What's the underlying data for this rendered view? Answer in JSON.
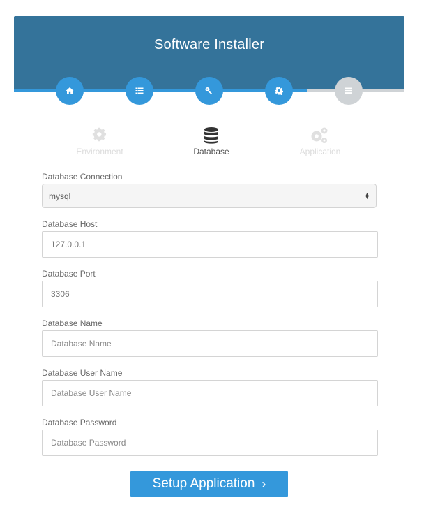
{
  "header": {
    "title": "Software Installer"
  },
  "steps": [
    {
      "icon": "home-icon",
      "state": "complete"
    },
    {
      "icon": "list-icon",
      "state": "complete"
    },
    {
      "icon": "key-icon",
      "state": "complete"
    },
    {
      "icon": "gear-icon",
      "state": "complete"
    },
    {
      "icon": "server-icon",
      "state": "inactive"
    }
  ],
  "tabs": [
    {
      "label": "Environment",
      "icon": "gear-icon",
      "state": "faded"
    },
    {
      "label": "Database",
      "icon": "database-icon",
      "state": "active"
    },
    {
      "label": "Application",
      "icon": "gears-icon",
      "state": "faded"
    }
  ],
  "form": {
    "connection": {
      "label": "Database Connection",
      "value": "mysql"
    },
    "host": {
      "label": "Database Host",
      "value": "127.0.0.1"
    },
    "port": {
      "label": "Database Port",
      "value": "3306"
    },
    "name": {
      "label": "Database Name",
      "placeholder": "Database Name"
    },
    "username": {
      "label": "Database User Name",
      "placeholder": "Database User Name"
    },
    "password": {
      "label": "Database Password",
      "placeholder": "Database Password"
    }
  },
  "submit": {
    "label": "Setup Application",
    "chevron": "›"
  },
  "colors": {
    "header": "#34739a",
    "accent": "#3498db",
    "inactive": "#cfd3d6"
  }
}
